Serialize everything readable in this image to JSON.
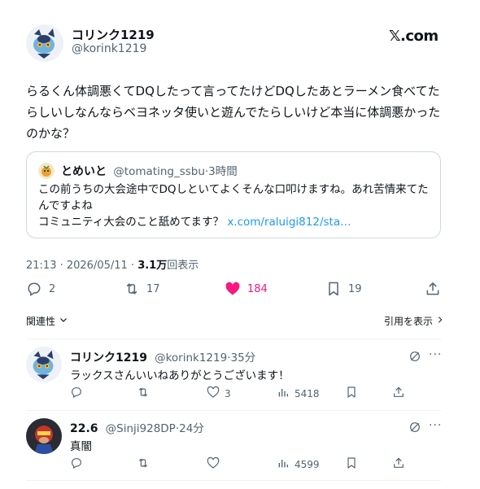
{
  "post": {
    "author": {
      "name": "コリンク1219",
      "handle": "@korink1219"
    },
    "brand": "𝕏.com",
    "text_lines": [
      "らるくん体調悪くてDQしたって言ってたけどDQしたあとラーメン食べてた",
      "らしいしなんならベヨネッタ使いと遊んでたらしいけど本当に体調悪かった",
      "のかな？"
    ],
    "quote": {
      "name": "とめいと",
      "handle": "@tomating_ssbu",
      "time": "·3時間",
      "lines": [
        "この前うちの大会途中でDQしといてよくそんな口叩けますね。あれ苦情来てた",
        "んですよね",
        "コミュニティ大会のこと舐めてます？ "
      ],
      "link": "x.com/raluigi812/sta…"
    },
    "timestamp": "21:13 · 2026/05/11 · ",
    "views_count": "3.1万",
    "views_label": "回表示",
    "actions": {
      "replies": "2",
      "reposts": "17",
      "likes": "184",
      "bookmarks": "19"
    },
    "related_label": "関連性",
    "quotes_link": "引用を表示"
  },
  "replies": [
    {
      "name": "コリンク1219",
      "handle": "@korink1219",
      "time": "·35分",
      "text": "ラックスさんいいねありがとうございます！",
      "replies": "",
      "reposts": "",
      "likes": "3",
      "views": "5418"
    },
    {
      "name": "22.6",
      "handle": "@Sinji928DP",
      "time": "·24分",
      "text": "真闇",
      "replies": "",
      "reposts": "",
      "likes": "",
      "views": "4599"
    }
  ],
  "colors": {
    "like": "#f91880",
    "link": "#1d9bf0",
    "muted": "#536471",
    "border": "#cfd9de"
  }
}
